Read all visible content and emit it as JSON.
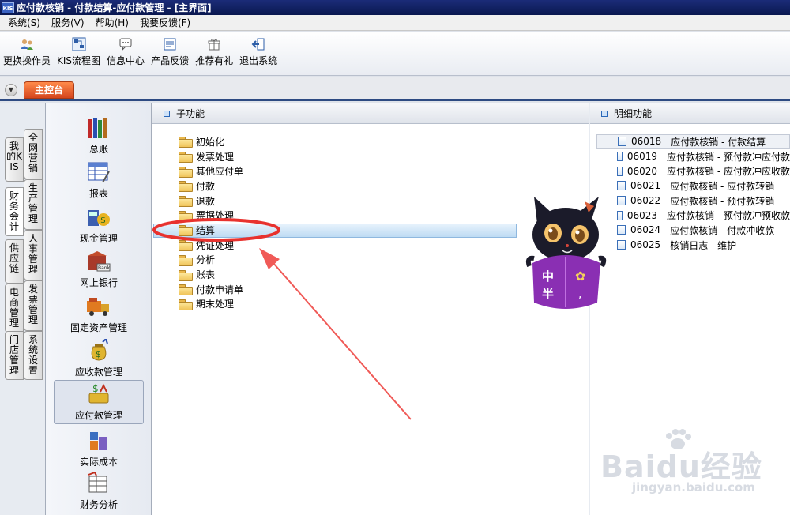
{
  "window": {
    "icon_label": "KIS",
    "title": "应付款核销 - 付款结算-应付款管理 - [主界面]"
  },
  "menu": [
    "系统(S)",
    "服务(V)",
    "帮助(H)",
    "我要反馈(F)"
  ],
  "toolbar": [
    {
      "label": "更换操作员",
      "icon": "user-switch-icon"
    },
    {
      "label": "KIS流程图",
      "icon": "flowchart-icon"
    },
    {
      "label": "信息中心",
      "icon": "message-icon"
    },
    {
      "label": "产品反馈",
      "icon": "feedback-icon"
    },
    {
      "label": "推荐有礼",
      "icon": "gift-icon"
    },
    {
      "label": "退出系统",
      "icon": "exit-icon"
    }
  ],
  "main_tab": "主控台",
  "side_tabs_left": [
    "我的KIS",
    "财务会计",
    "供应链",
    "电商管理",
    "门店管理"
  ],
  "side_tabs_right": [
    "全网营销",
    "生产管理",
    "人事管理",
    "发票管理",
    "系统设置"
  ],
  "modules": [
    {
      "label": "总账",
      "icon": "ledger-books-icon"
    },
    {
      "label": "报表",
      "icon": "report-icon"
    },
    {
      "label": "现金管理",
      "icon": "cash-icon"
    },
    {
      "label": "网上银行",
      "icon": "bank-icon"
    },
    {
      "label": "固定资产管理",
      "icon": "truck-icon"
    },
    {
      "label": "应收款管理",
      "icon": "money-bag-icon"
    },
    {
      "label": "应付款管理",
      "icon": "payable-icon"
    },
    {
      "label": "实际成本",
      "icon": "cost-blocks-icon"
    },
    {
      "label": "财务分析",
      "icon": "analysis-icon"
    }
  ],
  "subpanel": {
    "title": "子功能",
    "items": [
      "初始化",
      "发票处理",
      "其他应付单",
      "付款",
      "退款",
      "票据处理",
      "结算",
      "凭证处理",
      "分析",
      "账表",
      "付款申请单",
      "期末处理"
    ],
    "selected": "结算"
  },
  "detail": {
    "title": "明细功能",
    "items": [
      {
        "code": "06018",
        "name": "应付款核销 - 付款结算"
      },
      {
        "code": "06019",
        "name": "应付款核销 - 预付款冲应付款"
      },
      {
        "code": "06020",
        "name": "应付款核销 - 应付款冲应收款"
      },
      {
        "code": "06021",
        "name": "应付款核销 - 应付款转销"
      },
      {
        "code": "06022",
        "name": "应付款核销 - 预付款转销"
      },
      {
        "code": "06023",
        "name": "应付款核销 - 预付款冲预收款"
      },
      {
        "code": "06024",
        "name": "应付款核销 - 付款冲收款"
      },
      {
        "code": "06025",
        "name": "核销日志 - 维护"
      }
    ]
  },
  "mascot": {
    "chars": [
      "中",
      "半"
    ]
  },
  "watermark": {
    "big": "Baidu经验",
    "small": "jingyan.baidu.com"
  }
}
